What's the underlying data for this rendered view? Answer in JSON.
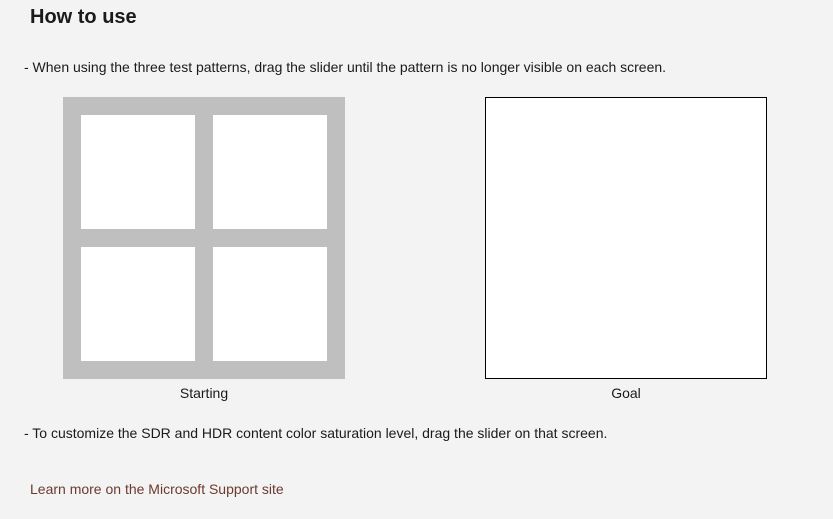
{
  "section": {
    "title": "How to use",
    "instruction1": "- When using the three test patterns, drag the slider until the pattern is no longer visible on each screen.",
    "instruction2": "- To customize the SDR and HDR content color saturation level, drag the slider on that screen.",
    "learn_more": "Learn more on the Microsoft Support site"
  },
  "examples": {
    "starting_caption": "Starting",
    "goal_caption": "Goal"
  }
}
